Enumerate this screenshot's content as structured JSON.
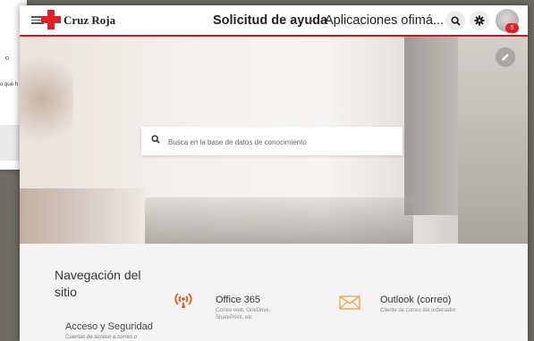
{
  "background_window": {
    "text1": "o",
    "text2": "o qué h"
  },
  "header": {
    "logo_text": "Cruz Roja",
    "breadcrumb_current": "Solicitud de ayuda",
    "breadcrumb_separator": "›",
    "breadcrumb_child": "Aplicaciones ofimá...",
    "notification_count": "6",
    "accent_color": "#e21e26"
  },
  "hero": {
    "search_placeholder": "Busca en la base de datos de conocimiento"
  },
  "site_nav": {
    "title": "Navegación del sitio",
    "item_label": "Acceso y Seguridad",
    "item_desc": "Cuentas de acceso a correo o"
  },
  "cards": [
    {
      "title": "Office 365",
      "desc_line1": "Correo web, OneDrive,",
      "desc_line2": "SharePoint, etc",
      "icon": "broadcast-icon"
    },
    {
      "title": "Outlook (correo)",
      "desc_line1": "Cliente de correo del ordenador",
      "icon": "envelope-icon"
    }
  ]
}
